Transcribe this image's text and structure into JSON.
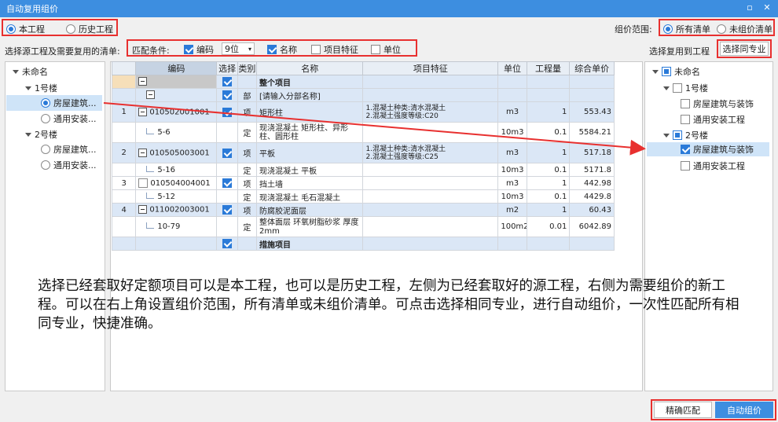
{
  "window": {
    "title": "自动复用组价"
  },
  "source_mode": {
    "options": [
      "本工程",
      "历史工程"
    ],
    "selected": 0
  },
  "scope": {
    "label": "组价范围:",
    "options": [
      "所有清单",
      "未组价清单"
    ],
    "selected": 0
  },
  "row2": {
    "left_label": "选择源工程及需要复用的清单:",
    "match_label": "匹配条件:",
    "conditions": [
      {
        "label": "编码",
        "checked": true
      },
      {
        "label": "名称",
        "checked": true
      },
      {
        "label": "项目特征",
        "checked": false
      },
      {
        "label": "单位",
        "checked": false
      }
    ],
    "digits_value": "9位",
    "right_label": "选择复用到工程",
    "same_major_button": "选择同专业"
  },
  "left_tree": {
    "root": "未命名",
    "groups": [
      {
        "label": "1号楼",
        "items": [
          "房屋建筑...",
          "通用安装..."
        ]
      },
      {
        "label": "2号楼",
        "items": [
          "房屋建筑...",
          "通用安装..."
        ]
      }
    ]
  },
  "grid": {
    "headers": [
      "编码",
      "选择",
      "类别",
      "名称",
      "项目特征",
      "单位",
      "工程量",
      "综合单价"
    ],
    "rows": [
      {
        "no": "",
        "code": "",
        "type": "",
        "name": "整个项目",
        "feature": "",
        "unit": "",
        "qty": "",
        "price": ""
      },
      {
        "no": "",
        "code": "",
        "type": "部",
        "name": "[请输入分部名称]",
        "feature": "",
        "unit": "",
        "qty": "",
        "price": ""
      },
      {
        "no": "1",
        "code": "010502001001",
        "type": "项",
        "name": "矩形柱",
        "feature": "1.混凝土种类:清水混凝土\n2.混凝土强度等级:C20",
        "unit": "m3",
        "qty": "1",
        "price": "553.43"
      },
      {
        "no": "",
        "code": "5-6",
        "type": "定",
        "name": "现浇混凝土 矩形柱、异形柱、圆形柱",
        "feature": "",
        "unit": "10m3",
        "qty": "0.1",
        "price": "5584.21"
      },
      {
        "no": "2",
        "code": "010505003001",
        "type": "项",
        "name": "平板",
        "feature": "1.混凝土种类:清水混凝土\n2.混凝土强度等级:C25",
        "unit": "m3",
        "qty": "1",
        "price": "517.18"
      },
      {
        "no": "",
        "code": "5-16",
        "type": "定",
        "name": "现浇混凝土 平板",
        "feature": "",
        "unit": "10m3",
        "qty": "0.1",
        "price": "5171.8"
      },
      {
        "no": "3",
        "code": "010504004001",
        "type": "项",
        "name": "挡土墙",
        "feature": "",
        "unit": "m3",
        "qty": "1",
        "price": "442.98"
      },
      {
        "no": "",
        "code": "5-12",
        "type": "定",
        "name": "现浇混凝土 毛石混凝土",
        "feature": "",
        "unit": "10m3",
        "qty": "0.1",
        "price": "4429.8"
      },
      {
        "no": "4",
        "code": "011002003001",
        "type": "项",
        "name": "防腐胶泥面层",
        "feature": "",
        "unit": "m2",
        "qty": "1",
        "price": "60.43"
      },
      {
        "no": "",
        "code": "10-79",
        "type": "定",
        "name": "整体面层 环氧树脂砂浆 厚度2mm",
        "feature": "",
        "unit": "100m2",
        "qty": "0.01",
        "price": "6042.89"
      },
      {
        "no": "",
        "code": "",
        "type": "",
        "name": "措施项目",
        "feature": "",
        "unit": "",
        "qty": "",
        "price": ""
      }
    ]
  },
  "right_tree": {
    "root": "未命名",
    "groups": [
      {
        "label": "1号楼",
        "items": [
          "房屋建筑与装饰",
          "通用安装工程"
        ]
      },
      {
        "label": "2号楼",
        "items": [
          "房屋建筑与装饰",
          "通用安装工程"
        ]
      }
    ]
  },
  "description": "选择已经套取好定额项目可以是本工程，也可以是历史工程，左侧为已经套取好的源工程，右侧为需要组价的新工程。可以在右上角设置组价范围，所有清单或未组价清单。可点击选择相同专业，进行自动组价，一次性匹配所有相同专业，快捷准确。",
  "buttons": {
    "precise": "精确匹配",
    "auto": "自动组价"
  },
  "colors": {
    "accent": "#3d8ee0",
    "highlight": "#e8302f",
    "row_blue": "#dbe7f6"
  }
}
